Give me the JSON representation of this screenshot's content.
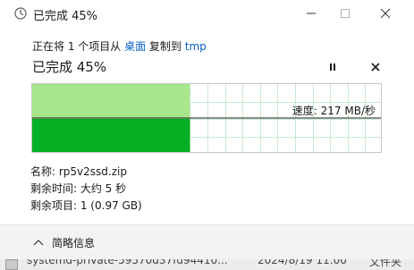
{
  "window": {
    "title": "已完成 45%",
    "icon": "clock-icon"
  },
  "copy": {
    "prefix": "正在将 1 个项目从 ",
    "source": "桌面",
    "middle": " 复制到 ",
    "destination": "tmp"
  },
  "progress": {
    "title": "已完成 45%",
    "fraction": 0.45,
    "speed_label": "速度: 217 MB/秒"
  },
  "details": {
    "name_line": "名称: rp5v2ssd.zip",
    "time_line": "剩余时间: 大约 5 秒",
    "items_line": "剩余项目: 1 (0.97 GB)"
  },
  "footer": {
    "toggle_label": "简略信息"
  },
  "background_row": {
    "name": "systemd-private-59570d37fd94410...",
    "date": "2024/8/19 11:00",
    "type": "文件夹"
  },
  "colors": {
    "accent": "#0a62c4",
    "graph_fill_light": "#a8e68b",
    "graph_fill_dark": "#06b025",
    "graph_grid": "#c9e8d0"
  }
}
